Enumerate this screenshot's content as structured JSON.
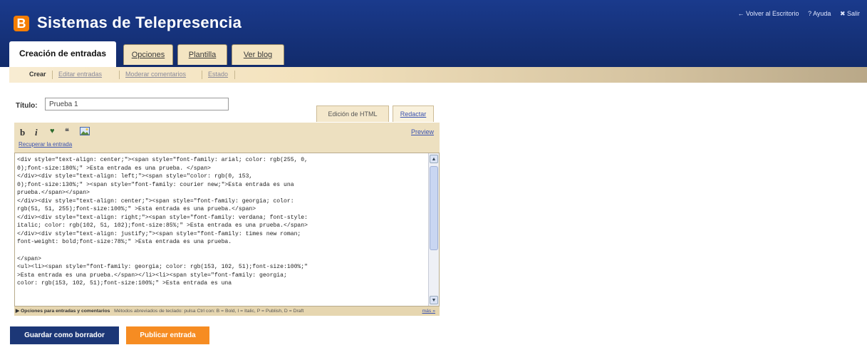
{
  "header": {
    "logo_letter": "B",
    "title": "Sistemas de Telepresencia",
    "links": [
      "← Volver al Escritorio",
      "? Ayuda",
      "✖ Salir"
    ]
  },
  "tabs": [
    {
      "label": "Creación de entradas",
      "active": true
    },
    {
      "label": "Opciones",
      "active": false
    },
    {
      "label": "Plantilla",
      "active": false
    },
    {
      "label": "Ver blog",
      "active": false
    }
  ],
  "subnav": [
    {
      "label": "Crear",
      "active": true
    },
    {
      "label": "Editar entradas",
      "active": false
    },
    {
      "label": "Moderar comentarios",
      "active": false
    },
    {
      "label": "Estado",
      "active": false
    }
  ],
  "post": {
    "title_label": "Título:",
    "title_value": "Prueba 1"
  },
  "editor": {
    "mode_html": "Edición de HTML",
    "mode_compose": "Redactar",
    "toolbar_icons": [
      "bold-icon",
      "italic-icon",
      "link-icon",
      "quote-icon",
      "image-icon"
    ],
    "preview": "Preview",
    "recover": "Recuperar la entrada",
    "content": "<div style=\"text-align: center;\"><span style=\"font-family: arial; color: rgb(255, 0,\n0);font-size:180%;\" >Esta entrada es una prueba. </span>\n</div><div style=\"text-align: left;\"><span style=\"color: rgb(0, 153,\n0);font-size:130%;\" ><span style=\"font-family: courier new;\">Esta entrada es una\nprueba.</span></span>\n</div><div style=\"text-align: center;\"><span style=\"font-family: georgia; color:\nrgb(51, 51, 255);font-size:100%;\" >Esta entrada es una prueba.</span>\n</div><div style=\"text-align: right;\"><span style=\"font-family: verdana; font-style:\nitalic; color: rgb(102, 51, 102);font-size:85%;\" >Esta entrada es una prueba.</span>\n</div><div style=\"text-align: justify;\"><span style=\"font-family: times new roman;\nfont-weight: bold;font-size:78%;\" >Esta entrada es una prueba.\n\n</span>\n<ul><li><span style=\"font-family: georgia; color: rgb(153, 102, 51);font-size:100%;\"\n>Esta entrada es una prueba.</span></li><li><span style=\"font-family: georgia;\ncolor: rgb(153, 102, 51);font-size:100%;\" >Esta entrada es una"
  },
  "options_bar": {
    "label": "▶ Opciones para entradas y comentarios",
    "shortcuts": "Métodos abreviados de teclado: pulsa Ctrl con: B = Bold, I = Italic, P = Publish, D = Draft",
    "more": "más »"
  },
  "buttons": {
    "save_draft": "Guardar como borrador",
    "publish": "Publicar entrada"
  }
}
